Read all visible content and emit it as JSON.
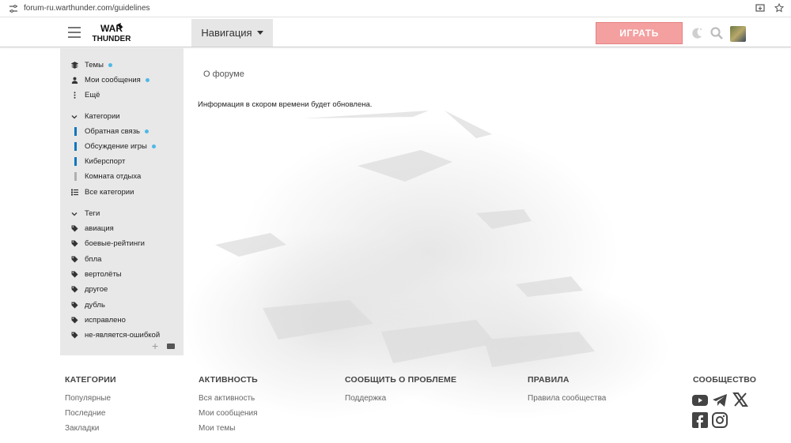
{
  "browser": {
    "url": "forum-ru.warthunder.com/guidelines"
  },
  "header": {
    "logo_text_line1": "WAR",
    "logo_text_line2": "THUNDER",
    "nav_label": "Навигация",
    "play_label": "ИГРАТЬ",
    "play_color": "#f4a0a0"
  },
  "sidebar": {
    "top_items": [
      {
        "label": "Темы",
        "icon": "layers-icon",
        "unread": true
      },
      {
        "label": "Мои сообщения",
        "icon": "user-icon",
        "unread": true
      },
      {
        "label": "Ещё",
        "icon": "more-vertical-icon",
        "unread": false
      }
    ],
    "categories_title": "Категории",
    "categories": [
      {
        "label": "Обратная связь",
        "color": "#0e76bd",
        "unread": true
      },
      {
        "label": "Обсуждение игры",
        "color": "#0e76bd",
        "unread": true
      },
      {
        "label": "Киберспорт",
        "color": "#0e76bd",
        "unread": false
      },
      {
        "label": "Комната отдыха",
        "color": "#b0b0b0",
        "unread": false
      },
      {
        "label": "Все категории",
        "color": "",
        "unread": false
      }
    ],
    "tags_title": "Теги",
    "tags": [
      "авиация",
      "боевые-рейтинги",
      "бпла",
      "вертолёты",
      "другое",
      "дубль",
      "исправлено",
      "не-является-ошибкой"
    ]
  },
  "main": {
    "breadcrumb": "О форуме",
    "info": "Информация в скором времени будет обновлена."
  },
  "footer": {
    "columns": [
      {
        "title": "КАТЕГОРИИ",
        "links": [
          "Популярные",
          "Последние",
          "Закладки"
        ]
      },
      {
        "title": "АКТИВНОСТЬ",
        "links": [
          "Вся активность",
          "Мои сообщения",
          "Мои темы"
        ]
      },
      {
        "title": "СООБЩИТЬ О ПРОБЛЕМЕ",
        "links": [
          "Поддержка"
        ]
      },
      {
        "title": "ПРАВИЛА",
        "links": [
          "Правила сообщества"
        ]
      },
      {
        "title": "СООБЩЕСТВО",
        "links": []
      }
    ],
    "social_icons": [
      "youtube-icon",
      "telegram-icon",
      "x-icon",
      "facebook-icon",
      "instagram-icon"
    ]
  }
}
